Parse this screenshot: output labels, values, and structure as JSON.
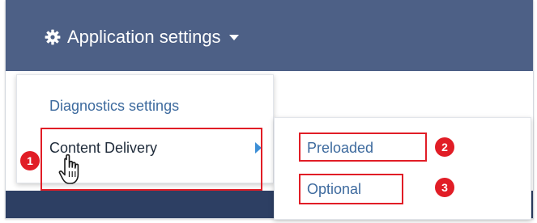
{
  "header": {
    "title": "Application settings",
    "gear_icon": "gear-icon",
    "caret_icon": "caret-down-icon"
  },
  "main_menu": {
    "items": [
      {
        "label": "Diagnostics settings"
      },
      {
        "label": "Content Delivery",
        "has_submenu": true
      }
    ]
  },
  "submenu": {
    "items": [
      {
        "label": "Preloaded"
      },
      {
        "label": "Optional"
      }
    ]
  },
  "annotations": {
    "badges": [
      "1",
      "2",
      "3"
    ],
    "highlight_color": "#e11d26"
  },
  "colors": {
    "header_bg": "#4d6086",
    "footer_bg": "#2d3f63",
    "link": "#3d6a9e",
    "accent_arrow": "#3d8fd6"
  },
  "cursor_icon": "hand-pointer-icon"
}
